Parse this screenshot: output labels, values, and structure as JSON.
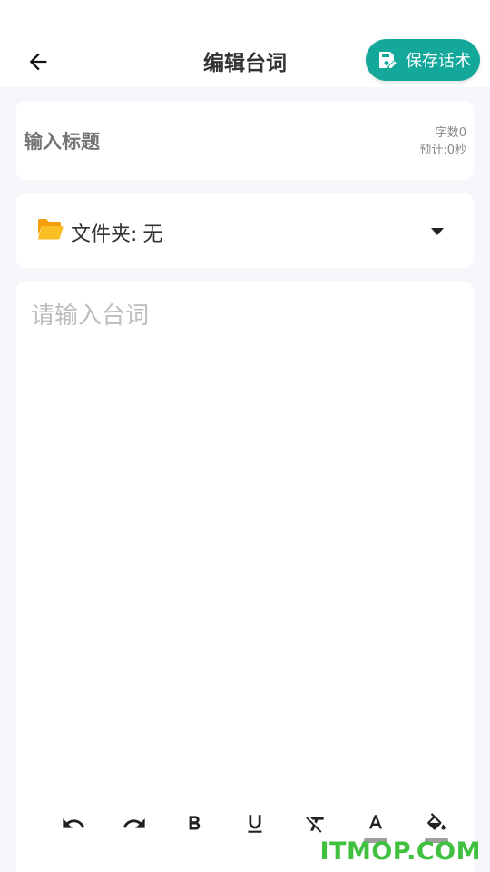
{
  "header": {
    "title": "编辑台词",
    "save_label": "保存话术"
  },
  "title_card": {
    "placeholder": "输入标题",
    "word_count": "字数0",
    "estimated_time": "预计:0秒"
  },
  "folder": {
    "label": "文件夹:",
    "value": "无"
  },
  "editor": {
    "placeholder": "请输入台词"
  },
  "toolbar": {
    "icons": [
      "undo-icon",
      "redo-icon",
      "bold-icon",
      "underline-icon",
      "clear-format-icon",
      "text-color-icon",
      "fill-color-icon"
    ]
  },
  "watermark": "ITMOP.COM",
  "colors": {
    "accent": "#14a89b",
    "folder_icon": "#fbbf24",
    "watermark": "#3fc13f"
  }
}
